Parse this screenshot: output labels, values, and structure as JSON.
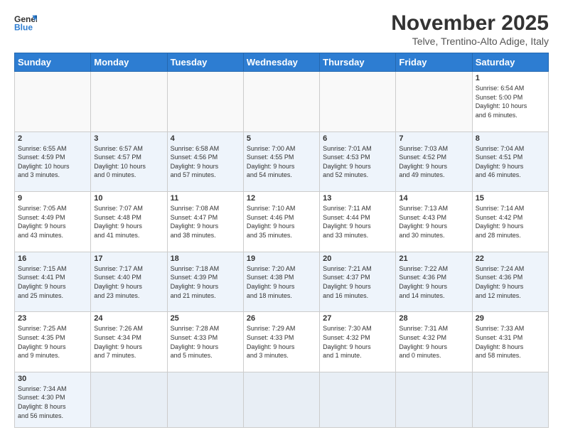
{
  "logo": {
    "general": "General",
    "blue": "Blue"
  },
  "title": "November 2025",
  "subtitle": "Telve, Trentino-Alto Adige, Italy",
  "days_of_week": [
    "Sunday",
    "Monday",
    "Tuesday",
    "Wednesday",
    "Thursday",
    "Friday",
    "Saturday"
  ],
  "weeks": [
    [
      {
        "day": "",
        "info": ""
      },
      {
        "day": "",
        "info": ""
      },
      {
        "day": "",
        "info": ""
      },
      {
        "day": "",
        "info": ""
      },
      {
        "day": "",
        "info": ""
      },
      {
        "day": "",
        "info": ""
      },
      {
        "day": "1",
        "info": "Sunrise: 6:54 AM\nSunset: 5:00 PM\nDaylight: 10 hours\nand 6 minutes."
      }
    ],
    [
      {
        "day": "2",
        "info": "Sunrise: 6:55 AM\nSunset: 4:59 PM\nDaylight: 10 hours\nand 3 minutes."
      },
      {
        "day": "3",
        "info": "Sunrise: 6:57 AM\nSunset: 4:57 PM\nDaylight: 10 hours\nand 0 minutes."
      },
      {
        "day": "4",
        "info": "Sunrise: 6:58 AM\nSunset: 4:56 PM\nDaylight: 9 hours\nand 57 minutes."
      },
      {
        "day": "5",
        "info": "Sunrise: 7:00 AM\nSunset: 4:55 PM\nDaylight: 9 hours\nand 54 minutes."
      },
      {
        "day": "6",
        "info": "Sunrise: 7:01 AM\nSunset: 4:53 PM\nDaylight: 9 hours\nand 52 minutes."
      },
      {
        "day": "7",
        "info": "Sunrise: 7:03 AM\nSunset: 4:52 PM\nDaylight: 9 hours\nand 49 minutes."
      },
      {
        "day": "8",
        "info": "Sunrise: 7:04 AM\nSunset: 4:51 PM\nDaylight: 9 hours\nand 46 minutes."
      }
    ],
    [
      {
        "day": "9",
        "info": "Sunrise: 7:05 AM\nSunset: 4:49 PM\nDaylight: 9 hours\nand 43 minutes."
      },
      {
        "day": "10",
        "info": "Sunrise: 7:07 AM\nSunset: 4:48 PM\nDaylight: 9 hours\nand 41 minutes."
      },
      {
        "day": "11",
        "info": "Sunrise: 7:08 AM\nSunset: 4:47 PM\nDaylight: 9 hours\nand 38 minutes."
      },
      {
        "day": "12",
        "info": "Sunrise: 7:10 AM\nSunset: 4:46 PM\nDaylight: 9 hours\nand 35 minutes."
      },
      {
        "day": "13",
        "info": "Sunrise: 7:11 AM\nSunset: 4:44 PM\nDaylight: 9 hours\nand 33 minutes."
      },
      {
        "day": "14",
        "info": "Sunrise: 7:13 AM\nSunset: 4:43 PM\nDaylight: 9 hours\nand 30 minutes."
      },
      {
        "day": "15",
        "info": "Sunrise: 7:14 AM\nSunset: 4:42 PM\nDaylight: 9 hours\nand 28 minutes."
      }
    ],
    [
      {
        "day": "16",
        "info": "Sunrise: 7:15 AM\nSunset: 4:41 PM\nDaylight: 9 hours\nand 25 minutes."
      },
      {
        "day": "17",
        "info": "Sunrise: 7:17 AM\nSunset: 4:40 PM\nDaylight: 9 hours\nand 23 minutes."
      },
      {
        "day": "18",
        "info": "Sunrise: 7:18 AM\nSunset: 4:39 PM\nDaylight: 9 hours\nand 21 minutes."
      },
      {
        "day": "19",
        "info": "Sunrise: 7:20 AM\nSunset: 4:38 PM\nDaylight: 9 hours\nand 18 minutes."
      },
      {
        "day": "20",
        "info": "Sunrise: 7:21 AM\nSunset: 4:37 PM\nDaylight: 9 hours\nand 16 minutes."
      },
      {
        "day": "21",
        "info": "Sunrise: 7:22 AM\nSunset: 4:36 PM\nDaylight: 9 hours\nand 14 minutes."
      },
      {
        "day": "22",
        "info": "Sunrise: 7:24 AM\nSunset: 4:36 PM\nDaylight: 9 hours\nand 12 minutes."
      }
    ],
    [
      {
        "day": "23",
        "info": "Sunrise: 7:25 AM\nSunset: 4:35 PM\nDaylight: 9 hours\nand 9 minutes."
      },
      {
        "day": "24",
        "info": "Sunrise: 7:26 AM\nSunset: 4:34 PM\nDaylight: 9 hours\nand 7 minutes."
      },
      {
        "day": "25",
        "info": "Sunrise: 7:28 AM\nSunset: 4:33 PM\nDaylight: 9 hours\nand 5 minutes."
      },
      {
        "day": "26",
        "info": "Sunrise: 7:29 AM\nSunset: 4:33 PM\nDaylight: 9 hours\nand 3 minutes."
      },
      {
        "day": "27",
        "info": "Sunrise: 7:30 AM\nSunset: 4:32 PM\nDaylight: 9 hours\nand 1 minute."
      },
      {
        "day": "28",
        "info": "Sunrise: 7:31 AM\nSunset: 4:32 PM\nDaylight: 9 hours\nand 0 minutes."
      },
      {
        "day": "29",
        "info": "Sunrise: 7:33 AM\nSunset: 4:31 PM\nDaylight: 8 hours\nand 58 minutes."
      }
    ],
    [
      {
        "day": "30",
        "info": "Sunrise: 7:34 AM\nSunset: 4:30 PM\nDaylight: 8 hours\nand 56 minutes."
      },
      {
        "day": "",
        "info": ""
      },
      {
        "day": "",
        "info": ""
      },
      {
        "day": "",
        "info": ""
      },
      {
        "day": "",
        "info": ""
      },
      {
        "day": "",
        "info": ""
      },
      {
        "day": "",
        "info": ""
      }
    ]
  ]
}
